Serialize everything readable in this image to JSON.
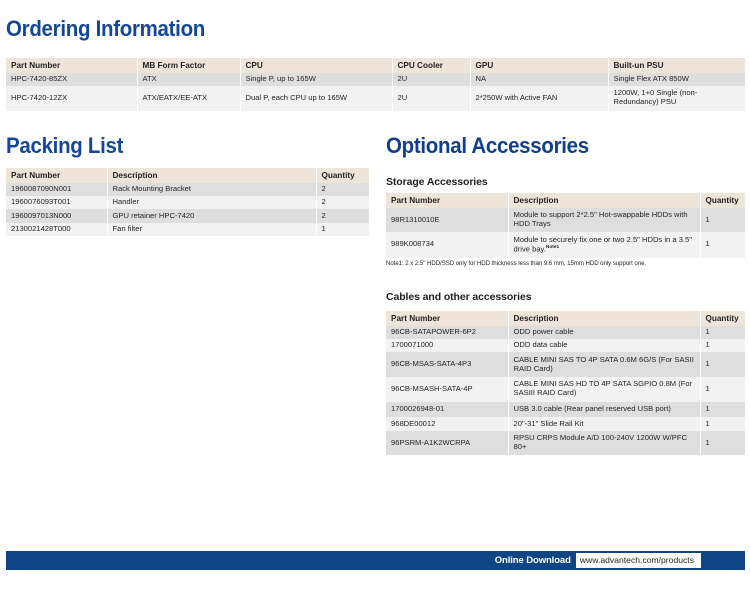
{
  "sections": {
    "ordering": {
      "title": "Ordering Information",
      "columns": [
        "Part Number",
        "MB Form Factor",
        "CPU",
        "CPU Cooler",
        "GPU",
        "Built-un PSU"
      ],
      "rows": [
        {
          "part_number": "HPC-7420-85ZX",
          "mb_form_factor": "ATX",
          "cpu": "Single P, up to 165W",
          "cpu_cooler": "2U",
          "gpu": "NA",
          "psu": "Single Flex ATX 850W"
        },
        {
          "part_number": "HPC-7420-12ZX",
          "mb_form_factor": "ATX/EATX/EE-ATX",
          "cpu": "Dual P, each CPU up to 165W",
          "cpu_cooler": "2U",
          "gpu": "2*250W with Active FAN",
          "psu": "1200W, 1+0 Single (non-Redundancy) PSU"
        }
      ]
    },
    "packing": {
      "title": "Packing List",
      "columns": [
        "Part Number",
        "Description",
        "Quantity"
      ],
      "rows": [
        {
          "part_number": "1960087090N001",
          "description": "Rack Mounting Bracket",
          "quantity": "2"
        },
        {
          "part_number": "1960076093T001",
          "description": "Handler",
          "quantity": "2"
        },
        {
          "part_number": "1960097013N000",
          "description": "GPU retainer HPC-7420",
          "quantity": "2"
        },
        {
          "part_number": "2130021428T000",
          "description": "Fan filter",
          "quantity": "1"
        }
      ]
    },
    "optional": {
      "title": "Optional Accessories",
      "storage": {
        "subtitle": "Storage Accessories",
        "columns": [
          "Part Number",
          "Description",
          "Quantity"
        ],
        "rows": [
          {
            "part_number": "98R1310010E",
            "description": "Module to support 2*2.5\" Hot-swappable HDDs with HDD Trays",
            "note": "",
            "quantity": "1"
          },
          {
            "part_number": "989K008734",
            "description": "Module to securely fix one or two 2.5\" HDDs in a 3.5\" drive bay.",
            "note": "Note1",
            "quantity": "1"
          }
        ],
        "footnote": "Note1: 2 x 2.5\" HDD/SSD only for HDD thickness less than 9.6 mm, 15mm HDD only support one."
      },
      "cables": {
        "subtitle": "Cables and other accessories",
        "columns": [
          "Part Number",
          "Description",
          "Quantity"
        ],
        "rows": [
          {
            "part_number": "96CB-SATAPOWER-6P2",
            "description": "ODD power cable",
            "quantity": "1"
          },
          {
            "part_number": "1700071000",
            "description": "ODD data cable",
            "quantity": "1"
          },
          {
            "part_number": "96CB-MSAS-SATA-4P3",
            "description": "CABLE MINI SAS TO 4P SATA 0.6M 6G/S (For SASII RAID Card)",
            "quantity": "1"
          },
          {
            "part_number": "96CB-MSASH-SATA-4P",
            "description": "CABLE MINI SAS HD TO 4P SATA SGPIO 0.8M (For SASIII RAID Card)",
            "quantity": "1"
          },
          {
            "part_number": "1700026948-01",
            "description": "USB 3.0 cable (Rear panel reserved USB port)",
            "quantity": "1"
          },
          {
            "part_number": "968DE00012",
            "description": "20\"-31\" Slide Rail Kit",
            "quantity": "1"
          },
          {
            "part_number": "96PSRM-A1K2WCRPA",
            "description": "RPSU CRPS Module A/D 100-240V 1200W W/PFC 80+",
            "quantity": "1"
          }
        ]
      }
    }
  },
  "footer": {
    "label": "Online Download",
    "url": "www.advantech.com/products"
  },
  "colors": {
    "heading_blue": "#13479b",
    "table_header_beige": "#efe4d8",
    "row_dark": "#dedede",
    "row_light": "#f2f2f2",
    "footer_blue": "#104585"
  }
}
